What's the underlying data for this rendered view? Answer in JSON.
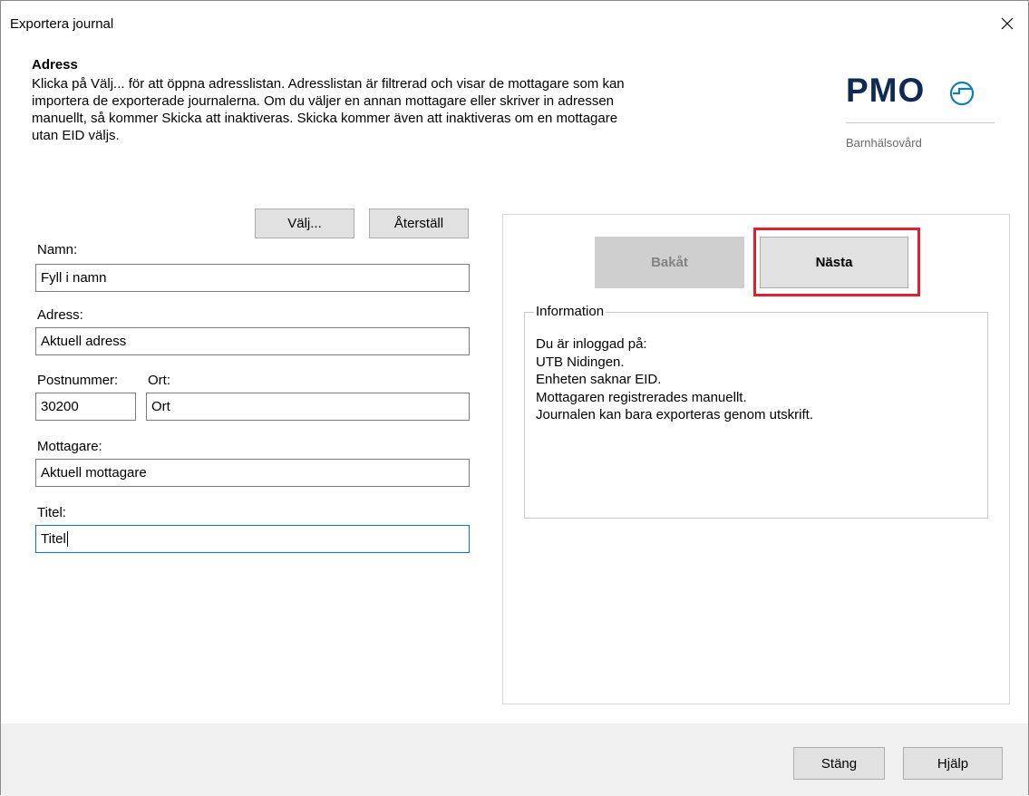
{
  "window": {
    "title": "Exportera journal"
  },
  "header": {
    "heading": "Adress",
    "description": [
      "Klicka på Välj... för att öppna adresslistan. Adresslistan är filtrerad och visar de mottagare som kan",
      "importera de exporterade journalerna. Om du väljer en annan mottagare eller skriver in adressen",
      "manuellt, så kommer Skicka att inaktiveras. Skicka kommer även att inaktiveras om en mottagare",
      "utan EID väljs."
    ]
  },
  "logo": {
    "name": "PMO",
    "subtitle": "Barnhälsovård",
    "color": "#0e2a55"
  },
  "address_form": {
    "choose_label": "Välj...",
    "reset_label": "Återställ",
    "name_label": "Namn:",
    "name_value": "Fyll i namn",
    "address_label": "Adress:",
    "address_value": "Aktuell adress",
    "postal_label": "Postnummer:",
    "postal_value": "30200",
    "city_label": "Ort:",
    "city_value": "Ort",
    "recipient_label": "Mottagare:",
    "recipient_value": "Aktuell mottagare",
    "title_label": "Titel:",
    "title_value": "Titel"
  },
  "wizard": {
    "back_label": "Bakåt",
    "next_label": "Nästa",
    "highlight_color": "#e0202e"
  },
  "information": {
    "legend": "Information",
    "lines": [
      "Du är inloggad på:",
      "UTB Nidingen.",
      "Enheten saknar EID.",
      "Mottagaren registrerades manuellt.",
      "Journalen kan bara exporteras genom utskrift."
    ]
  },
  "footer": {
    "close_label": "Stäng",
    "help_label": "Hjälp"
  }
}
